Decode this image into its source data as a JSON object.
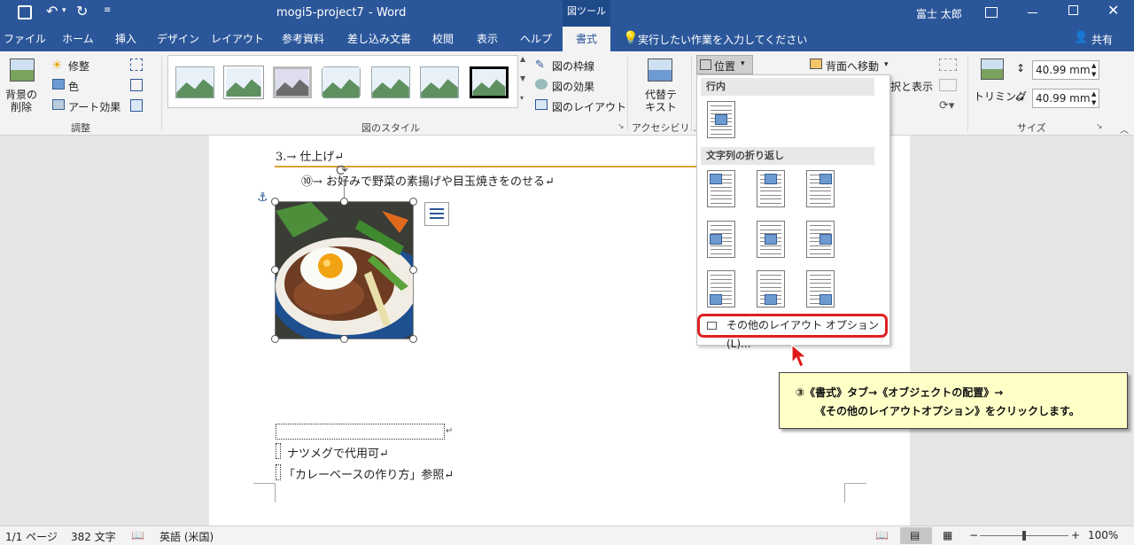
{
  "title": {
    "doc": "mogi5-project7",
    "sep": "-",
    "app": "Word",
    "context_tab": "図ツール",
    "user": "富士 太郎"
  },
  "tabs": [
    {
      "label": "ファイル"
    },
    {
      "label": "ホーム"
    },
    {
      "label": "挿入"
    },
    {
      "label": "デザイン"
    },
    {
      "label": "レイアウト"
    },
    {
      "label": "参考資料"
    },
    {
      "label": "差し込み文書"
    },
    {
      "label": "校閲"
    },
    {
      "label": "表示"
    },
    {
      "label": "ヘルプ"
    },
    {
      "label": "書式"
    }
  ],
  "tell_me": "実行したい作業を入力してください",
  "share": "共有",
  "ribbon": {
    "remove_bg": "背景の削除",
    "corrections": "修整",
    "color": "色",
    "artistic": "アート効果",
    "adjust_group": "調整",
    "styles_group": "図のスタイル",
    "border": "図の枠線",
    "effects": "図の効果",
    "layout": "図のレイアウト",
    "alt_text": "代替テキスト",
    "access_group": "アクセシビリ…",
    "position": "位置",
    "send_back": "背面へ移動",
    "select_pane": "択と表示",
    "crop": "トリミング",
    "height": "40.99 mm",
    "width": "40.99 mm",
    "size_group": "サイズ"
  },
  "dropdown": {
    "inline_header": "行内",
    "wrap_header": "文字列の折り返し",
    "more_options": "その他のレイアウト オプション(L)..."
  },
  "document": {
    "heading": "3.→ 仕上げ↵",
    "step": "⑩→ お好みで野菜の素揚げや目玉焼きをのせる↵",
    "line1": "ナツメグで代用可↵",
    "line2": "「カレーベースの作り方」参照↵"
  },
  "callout": {
    "line1": "③《書式》タブ→《オブジェクトの配置》→",
    "line2": "《その他のレイアウトオプション》をクリックします。"
  },
  "status": {
    "page": "1/1 ページ",
    "words": "382 文字",
    "lang": "英語 (米国)",
    "zoom": "100%"
  }
}
